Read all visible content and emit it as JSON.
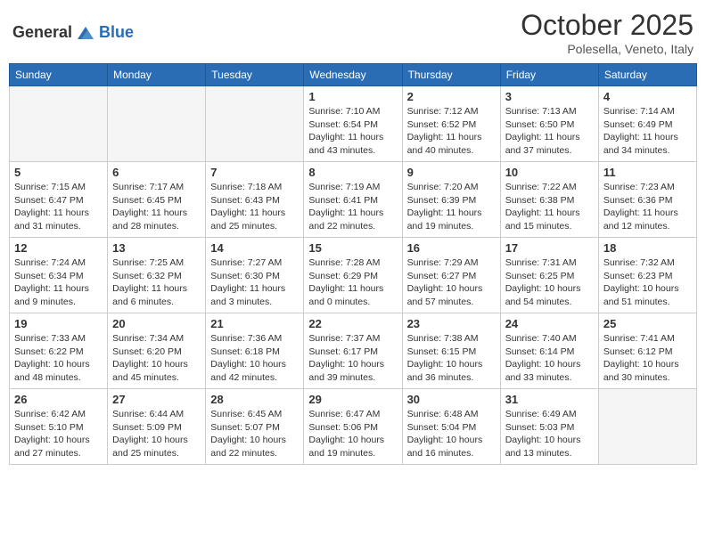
{
  "header": {
    "logo_general": "General",
    "logo_blue": "Blue",
    "title": "October 2025",
    "location": "Polesella, Veneto, Italy"
  },
  "days_of_week": [
    "Sunday",
    "Monday",
    "Tuesday",
    "Wednesday",
    "Thursday",
    "Friday",
    "Saturday"
  ],
  "weeks": [
    [
      {
        "day": "",
        "info": ""
      },
      {
        "day": "",
        "info": ""
      },
      {
        "day": "",
        "info": ""
      },
      {
        "day": "1",
        "info": "Sunrise: 7:10 AM\nSunset: 6:54 PM\nDaylight: 11 hours and 43 minutes."
      },
      {
        "day": "2",
        "info": "Sunrise: 7:12 AM\nSunset: 6:52 PM\nDaylight: 11 hours and 40 minutes."
      },
      {
        "day": "3",
        "info": "Sunrise: 7:13 AM\nSunset: 6:50 PM\nDaylight: 11 hours and 37 minutes."
      },
      {
        "day": "4",
        "info": "Sunrise: 7:14 AM\nSunset: 6:49 PM\nDaylight: 11 hours and 34 minutes."
      }
    ],
    [
      {
        "day": "5",
        "info": "Sunrise: 7:15 AM\nSunset: 6:47 PM\nDaylight: 11 hours and 31 minutes."
      },
      {
        "day": "6",
        "info": "Sunrise: 7:17 AM\nSunset: 6:45 PM\nDaylight: 11 hours and 28 minutes."
      },
      {
        "day": "7",
        "info": "Sunrise: 7:18 AM\nSunset: 6:43 PM\nDaylight: 11 hours and 25 minutes."
      },
      {
        "day": "8",
        "info": "Sunrise: 7:19 AM\nSunset: 6:41 PM\nDaylight: 11 hours and 22 minutes."
      },
      {
        "day": "9",
        "info": "Sunrise: 7:20 AM\nSunset: 6:39 PM\nDaylight: 11 hours and 19 minutes."
      },
      {
        "day": "10",
        "info": "Sunrise: 7:22 AM\nSunset: 6:38 PM\nDaylight: 11 hours and 15 minutes."
      },
      {
        "day": "11",
        "info": "Sunrise: 7:23 AM\nSunset: 6:36 PM\nDaylight: 11 hours and 12 minutes."
      }
    ],
    [
      {
        "day": "12",
        "info": "Sunrise: 7:24 AM\nSunset: 6:34 PM\nDaylight: 11 hours and 9 minutes."
      },
      {
        "day": "13",
        "info": "Sunrise: 7:25 AM\nSunset: 6:32 PM\nDaylight: 11 hours and 6 minutes."
      },
      {
        "day": "14",
        "info": "Sunrise: 7:27 AM\nSunset: 6:30 PM\nDaylight: 11 hours and 3 minutes."
      },
      {
        "day": "15",
        "info": "Sunrise: 7:28 AM\nSunset: 6:29 PM\nDaylight: 11 hours and 0 minutes."
      },
      {
        "day": "16",
        "info": "Sunrise: 7:29 AM\nSunset: 6:27 PM\nDaylight: 10 hours and 57 minutes."
      },
      {
        "day": "17",
        "info": "Sunrise: 7:31 AM\nSunset: 6:25 PM\nDaylight: 10 hours and 54 minutes."
      },
      {
        "day": "18",
        "info": "Sunrise: 7:32 AM\nSunset: 6:23 PM\nDaylight: 10 hours and 51 minutes."
      }
    ],
    [
      {
        "day": "19",
        "info": "Sunrise: 7:33 AM\nSunset: 6:22 PM\nDaylight: 10 hours and 48 minutes."
      },
      {
        "day": "20",
        "info": "Sunrise: 7:34 AM\nSunset: 6:20 PM\nDaylight: 10 hours and 45 minutes."
      },
      {
        "day": "21",
        "info": "Sunrise: 7:36 AM\nSunset: 6:18 PM\nDaylight: 10 hours and 42 minutes."
      },
      {
        "day": "22",
        "info": "Sunrise: 7:37 AM\nSunset: 6:17 PM\nDaylight: 10 hours and 39 minutes."
      },
      {
        "day": "23",
        "info": "Sunrise: 7:38 AM\nSunset: 6:15 PM\nDaylight: 10 hours and 36 minutes."
      },
      {
        "day": "24",
        "info": "Sunrise: 7:40 AM\nSunset: 6:14 PM\nDaylight: 10 hours and 33 minutes."
      },
      {
        "day": "25",
        "info": "Sunrise: 7:41 AM\nSunset: 6:12 PM\nDaylight: 10 hours and 30 minutes."
      }
    ],
    [
      {
        "day": "26",
        "info": "Sunrise: 6:42 AM\nSunset: 5:10 PM\nDaylight: 10 hours and 27 minutes."
      },
      {
        "day": "27",
        "info": "Sunrise: 6:44 AM\nSunset: 5:09 PM\nDaylight: 10 hours and 25 minutes."
      },
      {
        "day": "28",
        "info": "Sunrise: 6:45 AM\nSunset: 5:07 PM\nDaylight: 10 hours and 22 minutes."
      },
      {
        "day": "29",
        "info": "Sunrise: 6:47 AM\nSunset: 5:06 PM\nDaylight: 10 hours and 19 minutes."
      },
      {
        "day": "30",
        "info": "Sunrise: 6:48 AM\nSunset: 5:04 PM\nDaylight: 10 hours and 16 minutes."
      },
      {
        "day": "31",
        "info": "Sunrise: 6:49 AM\nSunset: 5:03 PM\nDaylight: 10 hours and 13 minutes."
      },
      {
        "day": "",
        "info": ""
      }
    ]
  ]
}
